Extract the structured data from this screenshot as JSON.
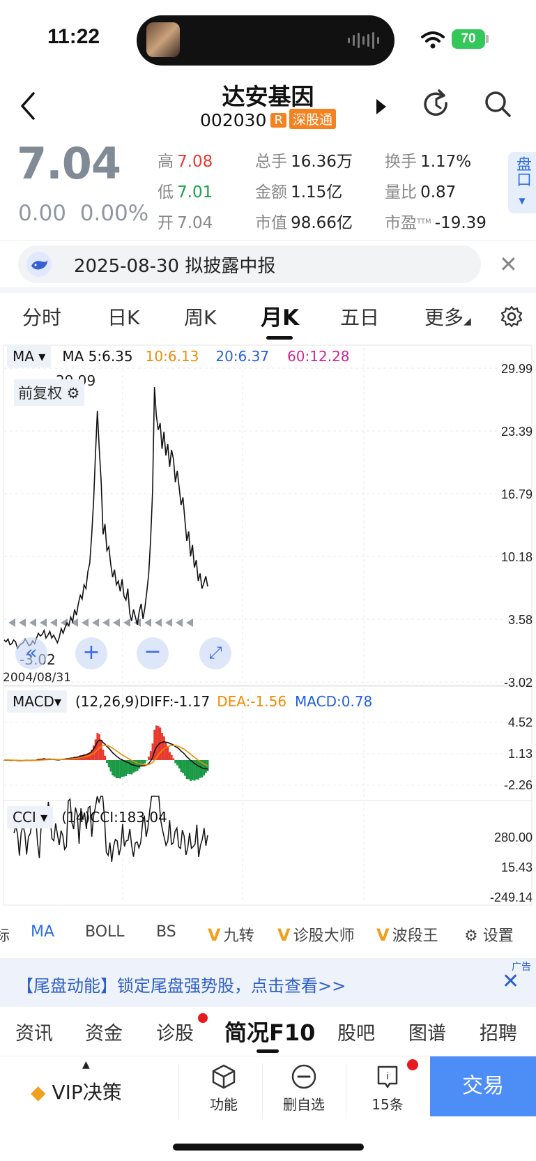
{
  "status_bar": {
    "time": "11:22",
    "battery": "70"
  },
  "header": {
    "stock_name": "达安基因",
    "stock_code": "002030",
    "badge_r": "R",
    "badge_market": "深股通"
  },
  "quote": {
    "price": "7.04",
    "change": "0.00",
    "change_pct": "0.00%",
    "high_label": "高",
    "high": "7.08",
    "low_label": "低",
    "low": "7.01",
    "open_label": "开",
    "open": "7.04",
    "volume_label": "总手",
    "volume": "16.36万",
    "amount_label": "金额",
    "amount": "1.15亿",
    "mktcap_label": "市值",
    "mktcap": "98.66亿",
    "turnover_label": "换手",
    "turnover": "1.17%",
    "volratio_label": "量比",
    "volratio": "0.87",
    "pe_label": "市盈",
    "pe_sup": "TTM",
    "pe": "-19.39",
    "side_tab": "盘口"
  },
  "notice": {
    "text": "2025-08-30 拟披露中报"
  },
  "period_tabs": [
    "分时",
    "日K",
    "周K",
    "月K",
    "五日",
    "更多"
  ],
  "active_period": "月K",
  "chart_toolbar": {
    "ma_chip": "MA",
    "ma5": "MA 5:6.35",
    "ma10": "10:6.13",
    "ma20": "20:6.37",
    "ma60": "60:12.28",
    "fq_label": "前复权",
    "max_marker": "29.99",
    "min_marker": "-3.02",
    "start_date": "2004/08/31",
    "macd_chip": "MACD",
    "macd_params": "(12,26,9)DIFF:-1.17",
    "macd_dea": "DEA:-1.56",
    "macd_val": "MACD:0.78",
    "cci_chip": "CCI",
    "cci_val": "(14)CCI:183.04",
    "colors": {
      "ma5": "#111111",
      "ma10": "#f08a00",
      "ma20": "#2060e0",
      "ma60": "#d02690"
    }
  },
  "chart_data": [
    {
      "type": "line",
      "name": "price",
      "ylim": [
        -3.02,
        29.99
      ],
      "tick_labels": [
        "29.99",
        "23.39",
        "16.79",
        "10.18",
        "3.58",
        "-3.02"
      ],
      "x": [
        "2004/08/31"
      ],
      "values": [
        1.4,
        1.2,
        1.5,
        0.9,
        1.0,
        1.4,
        1.2,
        0.5,
        0.8,
        1.0,
        1.1,
        1.5,
        1.2,
        0.8,
        0.9,
        1.3,
        1.0,
        1.6,
        2.1,
        1.8,
        2.0,
        2.4,
        1.6,
        1.9,
        2.3,
        1.6,
        1.9,
        1.5,
        1.1,
        1.7,
        2.6,
        2.1,
        2.7,
        3.2,
        2.9,
        3.8,
        3.3,
        4.6,
        4.0,
        5.2,
        6.1,
        5.7,
        7.2,
        6.8,
        8.6,
        9.5,
        12.4,
        16.0,
        21.0,
        25.5,
        21.5,
        18.0,
        12.5,
        13.6,
        10.8,
        11.2,
        9.4,
        8.0,
        8.8,
        7.2,
        7.6,
        6.5,
        7.8,
        6.0,
        5.6,
        6.8,
        4.2,
        3.4,
        4.6,
        3.8,
        3.0,
        4.4,
        5.2,
        3.6,
        4.8,
        6.5,
        8.4,
        12.0,
        17.0,
        28.0,
        25.0,
        23.5,
        24.2,
        21.5,
        23.3,
        20.8,
        22.0,
        19.6,
        21.4,
        20.4,
        18.0,
        19.2,
        17.4,
        15.6,
        16.4,
        14.0,
        11.8,
        12.8,
        10.2,
        11.4,
        9.0,
        9.8,
        7.6,
        8.4,
        6.8,
        7.4,
        8.1,
        7.04
      ]
    },
    {
      "type": "bar",
      "name": "MACD",
      "ylim": [
        -2.26,
        4.52
      ],
      "tick_labels": [
        "4.52",
        "1.13",
        "-2.26"
      ]
    },
    {
      "type": "line",
      "name": "CCI",
      "ylim": [
        -249.14,
        280.0
      ],
      "tick_labels": [
        "280.00",
        "15.43",
        "-249.14"
      ]
    }
  ],
  "indicator_bar": [
    "标",
    "MA",
    "BOLL",
    "BS",
    "九转",
    "诊股大师",
    "波段王",
    "设置"
  ],
  "ad": {
    "text": "【尾盘动能】锁定尾盘强势股，点击查看>>",
    "tag": "广告"
  },
  "bottom_tabs": [
    "资讯",
    "资金",
    "诊股",
    "简况F10",
    "股吧",
    "图谱",
    "招聘"
  ],
  "bottom_bar": {
    "vip": "VIP决策",
    "func": "功能",
    "remove": "删自选",
    "msgs": "15条",
    "trade": "交易"
  }
}
